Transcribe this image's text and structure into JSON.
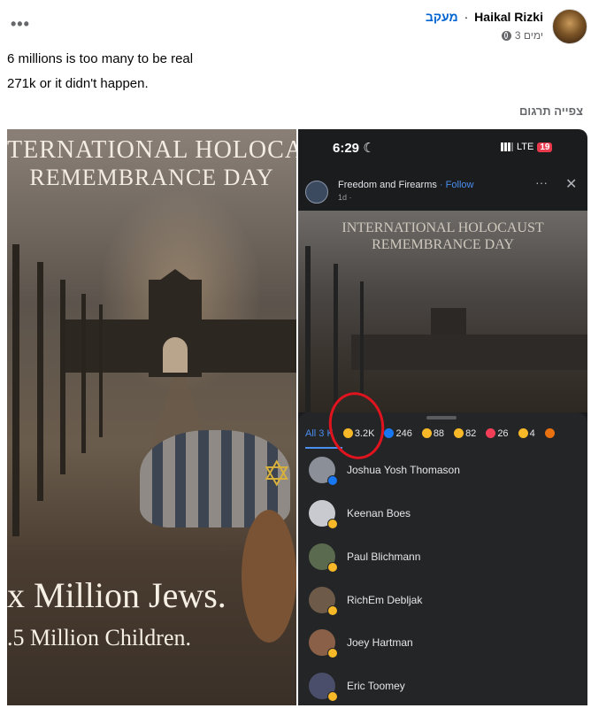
{
  "post": {
    "author": "Haikal Rizki",
    "separator": "·",
    "follow_label": "מעקב",
    "time": "3 ימים",
    "lines": [
      "6 millions is too many to be real",
      "271k or it didn't happen."
    ],
    "translate_label": "צפייה תרגום",
    "more_label": "•••"
  },
  "left_image": {
    "title_line1": "TERNATIONAL HOLOCAUS",
    "title_line2": "REMEMBRANCE DAY",
    "big_line1": "x Million Jews.",
    "big_line2": ".5 Million Children."
  },
  "right_image": {
    "status_time": "6:29",
    "moon": "☾",
    "network": "LTE",
    "battery": "19",
    "page_name": "Freedom and Firearms",
    "page_follow": "· Follow",
    "page_time": "1d ·",
    "dots": "···",
    "close": "✕",
    "title_line1": "INTERNATIONAL HOLOCAUST",
    "title_line2": "REMEMBRANCE DAY",
    "tabs": {
      "all": "All 3",
      "all_suffix": "K",
      "laugh": "3.2K",
      "like": "246",
      "sad": "88",
      "care": "82",
      "heart": "26",
      "wow": "4"
    },
    "reactors": [
      {
        "name": "Joshua Yosh Thomason"
      },
      {
        "name": "Keenan Boes"
      },
      {
        "name": "Paul Blichmann"
      },
      {
        "name": "RichEm Debljak"
      },
      {
        "name": "Joey Hartman"
      },
      {
        "name": "Eric Toomey"
      }
    ]
  },
  "colors": {
    "link_blue": "#0064d1",
    "annotation_red": "#e0141e",
    "laugh_yellow": "#f7b928",
    "like_blue": "#1877f2"
  }
}
